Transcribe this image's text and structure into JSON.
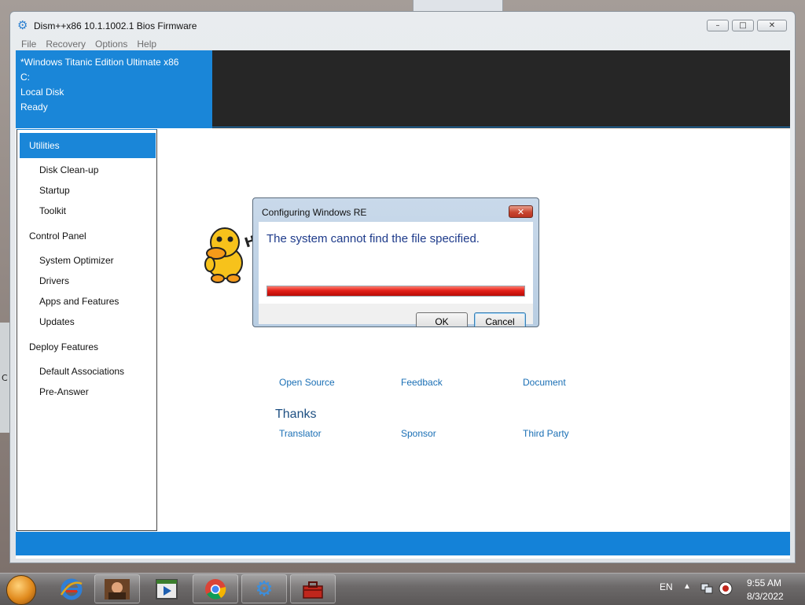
{
  "window": {
    "title": "Dism++x86 10.1.1002.1 Bios Firmware",
    "menu": [
      "File",
      "Recovery",
      "Options",
      "Help"
    ],
    "controls": {
      "minimize": "–",
      "maximize": "□",
      "close": "✕"
    }
  },
  "info": {
    "os_name": "*Windows Titanic Edition Ultimate x86",
    "drive": "C:",
    "disk_type": "Local Disk",
    "status": "Ready"
  },
  "sidebar": {
    "selected": "Utilities",
    "items": [
      "Disk Clean-up",
      "Startup",
      "Toolkit"
    ],
    "group_control_panel": "Control Panel",
    "control_panel_items": [
      "System Optimizer",
      "Drivers",
      "Apps and Features",
      "Updates"
    ],
    "group_deploy": "Deploy Features",
    "deploy_items": [
      "Default Associations",
      "Pre-Answer"
    ]
  },
  "content": {
    "mascot_text": "Hi~",
    "links_row1": [
      "Open Source",
      "Feedback",
      "Document"
    ],
    "thanks_heading": "Thanks",
    "links_row2": [
      "Translator",
      "Sponsor",
      "Third Party"
    ]
  },
  "dialog": {
    "title": "Configuring Windows RE",
    "message": "The system cannot find the file specified.",
    "progress_percent": 100,
    "progress_color": "#e22019",
    "ok_label": "OK",
    "cancel_label": "Cancel",
    "close_glyph": "✕"
  },
  "taskbar": {
    "apps": [
      "start-orb",
      "internet-explorer-icon",
      "photo-app-icon",
      "media-player-icon",
      "chrome-icon",
      "dism-gear-icon",
      "toolbox-icon"
    ],
    "language": "EN",
    "time": "9:55 AM",
    "date": "8/3/2022"
  },
  "colors": {
    "accent": "#1a86d8",
    "info_dark": "#262626",
    "link": "#1a6fb5"
  }
}
